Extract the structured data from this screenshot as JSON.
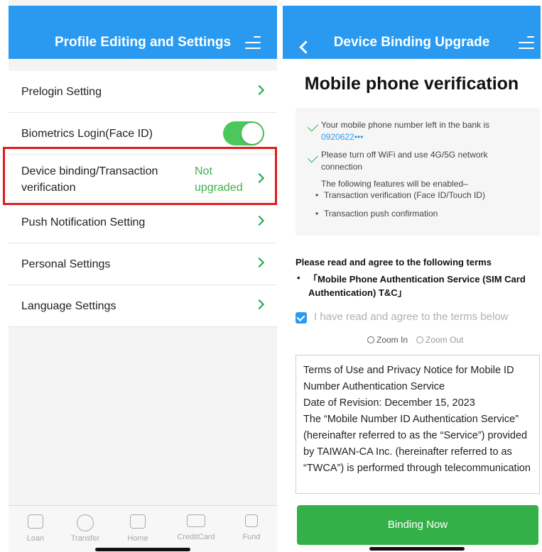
{
  "left": {
    "header_title": "Profile Editing and Settings",
    "items": [
      {
        "label": "Prelogin Setting"
      },
      {
        "label": "Biometrics Login(Face ID)"
      },
      {
        "label": "Device binding/Transaction verification",
        "status": "Not upgraded"
      },
      {
        "label": "Push Notification Setting"
      },
      {
        "label": "Personal Settings"
      },
      {
        "label": "Language Settings"
      }
    ],
    "tabs": [
      "Loan",
      "Transfer",
      "Home",
      "CreditCard",
      "Fund"
    ]
  },
  "right": {
    "header_title": "Device Binding Upgrade",
    "page_title": "Mobile phone verification",
    "info": {
      "line1": "Your mobile phone number left in the bank is",
      "phone": "0920622•••",
      "line2": "Please turn off WiFi and use 4G/5G network connection",
      "features_intro": "The following features will be enabled–",
      "feature1": "Transaction verification (Face ID/Touch ID)",
      "feature2": "Transaction push confirmation"
    },
    "terms_heading": "Please read and agree to the following terms",
    "terms_item": "「Mobile Phone Authentication Service (SIM Card Authentication) T&C」",
    "agree_label": "I have read and agree to the terms below",
    "zoom_in": "Zoom In",
    "zoom_out": "Zoom Out",
    "terms_text": "Terms of Use and Privacy Notice for Mobile ID Number Authentication Service\nDate of Revision: December 15, 2023\nThe “Mobile Number ID Authentication Service” (hereinafter referred to as the “Service”) provided by TAIWAN-CA Inc. (hereinafter referred to as “TWCA”) is performed through telecommunication",
    "bind_button": "Binding Now"
  },
  "colors": {
    "header_blue": "#2a9af0",
    "accent_green": "#34b049",
    "highlight_red": "#e31b1b"
  }
}
